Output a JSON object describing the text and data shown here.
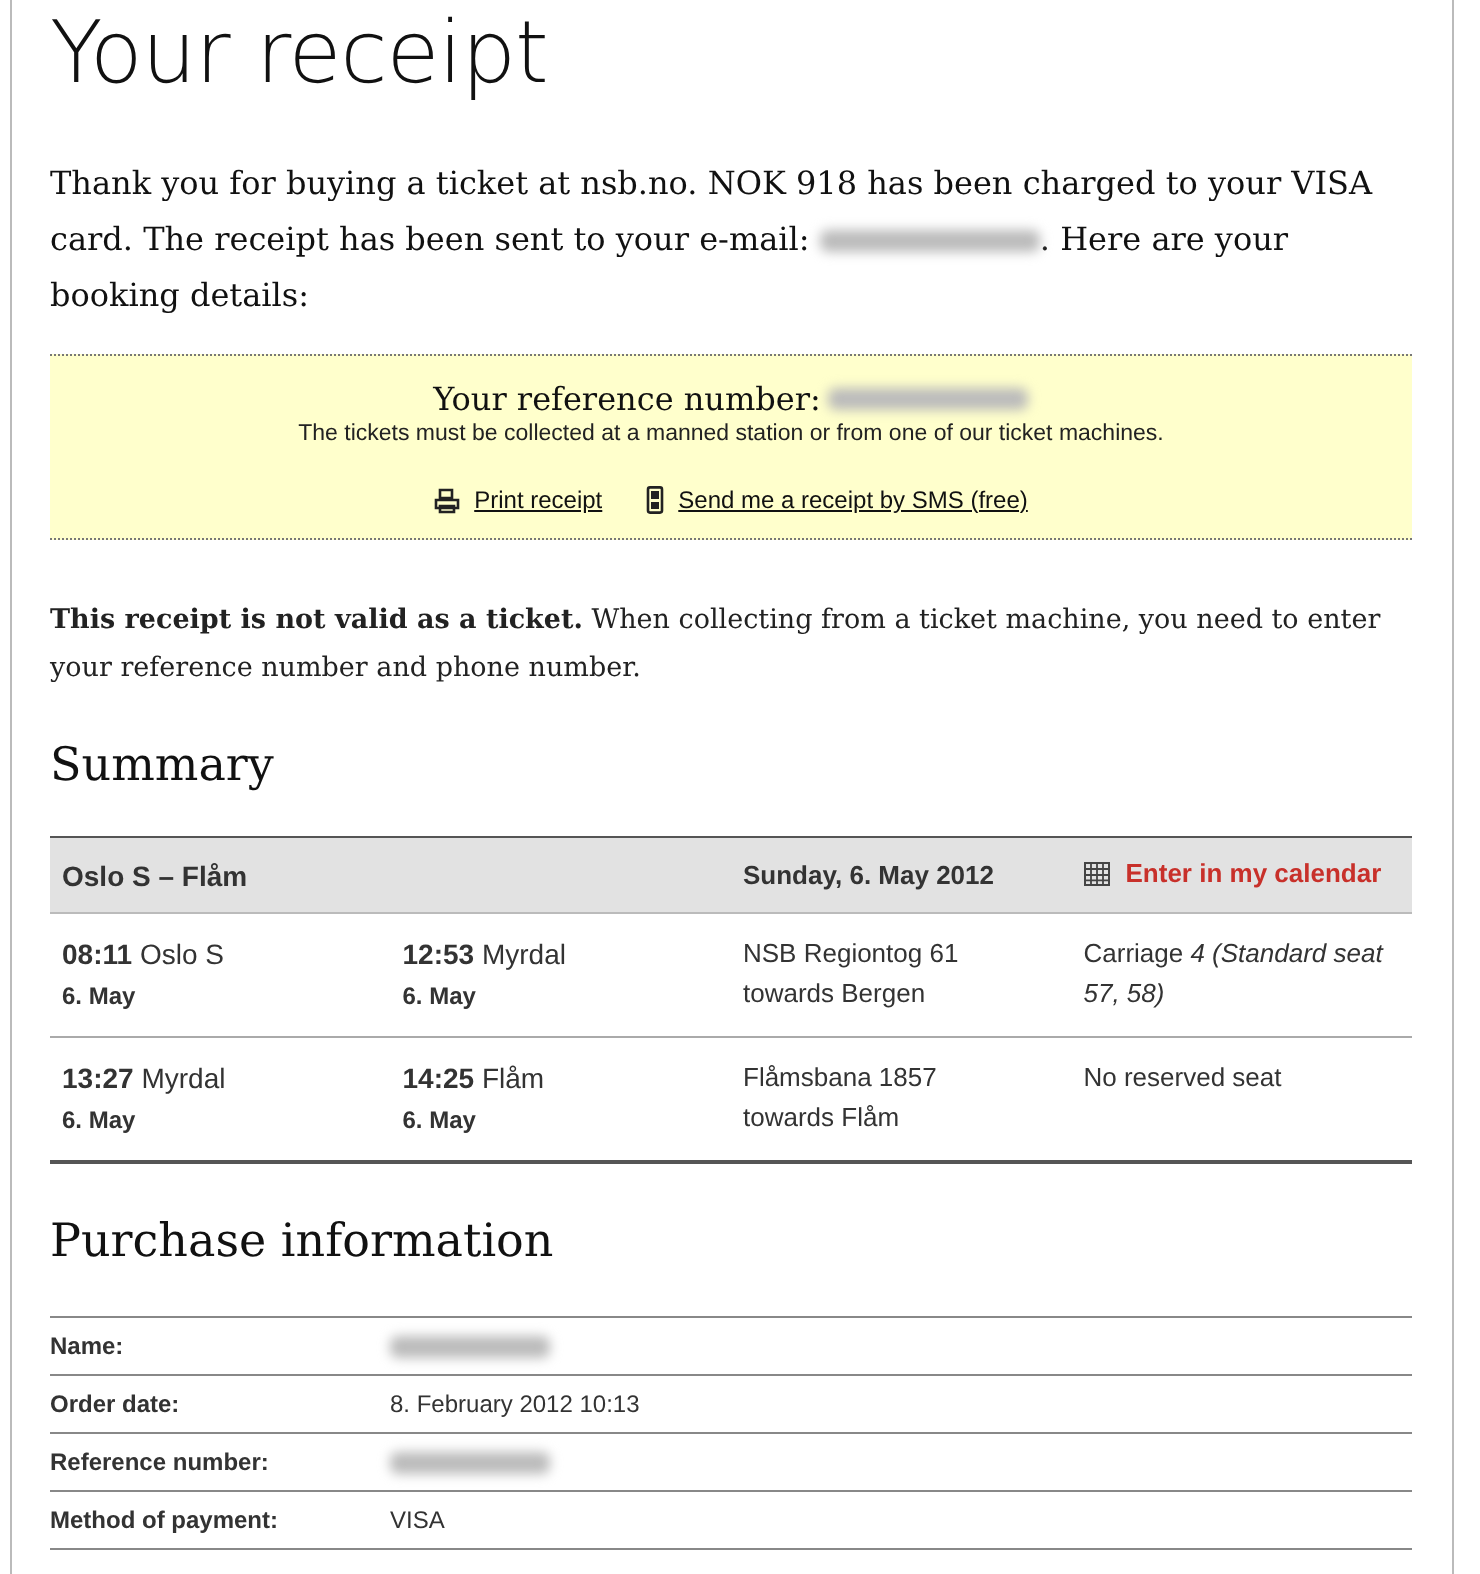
{
  "title": "Your receipt",
  "intro": {
    "text_before": "Thank you for buying a ticket at nsb.no. NOK 918 has been charged to your VISA card. The receipt has been sent to your e-mail: ",
    "email_redacted": true,
    "text_after": ". Here are your booking details:"
  },
  "reference_box": {
    "label": "Your reference number:",
    "number_redacted": true,
    "note": "The tickets must be collected at a manned station or from one of our ticket machines.",
    "links": [
      {
        "kind": "print",
        "label": "Print receipt"
      },
      {
        "kind": "sms",
        "label": "Send me a receipt by SMS (free)"
      }
    ]
  },
  "notice": "**This receipt is not valid as a ticket.** When collecting from a ticket machine, you need to enter your reference number and phone number.",
  "summary": {
    "heading": "Summary",
    "route": "Oslo S – Flåm",
    "date": "Sunday, 6. May 2012",
    "calendar_link": "Enter in my calendar",
    "legs": [
      {
        "dep_time": "08:11",
        "dep_station": "Oslo S",
        "dep_date": "6. May",
        "arr_time": "12:53",
        "arr_station": "Myrdal",
        "arr_date": "6. May",
        "train": "NSB Regiontog 61",
        "towards": "towards Bergen",
        "seat": "Carriage *4 (Standard seat 57, 58)*"
      },
      {
        "dep_time": "13:27",
        "dep_station": "Myrdal",
        "dep_date": "6. May",
        "arr_time": "14:25",
        "arr_station": "Flåm",
        "arr_date": "6. May",
        "train": "Flåmsbana 1857",
        "towards": "towards Flåm",
        "seat": "No reserved seat"
      }
    ]
  },
  "purchase": {
    "heading": "Purchase information",
    "rows": [
      {
        "label": "Name:",
        "redacted": true
      },
      {
        "label": "Order date:",
        "value": "8. February 2012 10:13",
        "redacted": false
      },
      {
        "label": "Reference number:",
        "redacted": true
      },
      {
        "label": "Method of payment:",
        "value": "VISA",
        "redacted": false
      }
    ]
  }
}
